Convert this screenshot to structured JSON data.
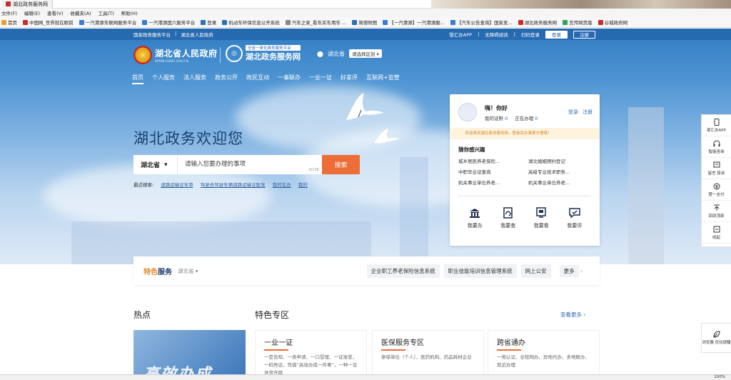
{
  "browser": {
    "tab_title": "湖北政务服务网",
    "menu": [
      "文件(F)",
      "编辑(E)",
      "查看(V)",
      "收藏夹(A)",
      "工具(T)",
      "帮助(H)"
    ],
    "favorites": [
      "首页",
      "中国网_世界就在眼前",
      "一汽港源车联网服务平台",
      "一汽港源国六服务平台",
      "登录",
      "机动车环保信息公开系统",
      "汽车之家_看车买车用车 ...",
      "周德附图",
      "【一汽港源】一汽港源服...",
      "【汽车公告查询】国家发...",
      "湖北政务服务网",
      "互传网页版",
      "谷城政府网"
    ],
    "zoom": "100%"
  },
  "topbar": {
    "left": [
      "国家政务服务平台",
      "湖北省人民政府"
    ],
    "right": [
      "鄂汇办APP",
      "无障碍阅读",
      "扫码登录"
    ],
    "login": "登录",
    "register": "注册"
  },
  "header": {
    "gov_name": "湖北省人民政府",
    "gov_sub": "WWW.HUBEI.GOV.CN",
    "portal_tag": "全省一体化政务服务平台",
    "portal_name": "湖北政务服务网",
    "region": "湖北省",
    "region_select": "请选择区划"
  },
  "nav": [
    "首页",
    "个人服务",
    "法人服务",
    "政务公开",
    "政民互动",
    "一事联办",
    "一业一证",
    "好差评",
    "互联网+监管"
  ],
  "hero": {
    "welcome": "湖北政务欢迎您",
    "province": "湖北省",
    "search_placeholder": "请输入您要办理的事项",
    "counter": "0/128",
    "search_button": "搜索",
    "hot_label": "最近搜索:",
    "hot_links": [
      "道路运输证年审",
      "驾驶员驾驶车辆道路运输证配发",
      "我的在办",
      "我的"
    ]
  },
  "user_card": {
    "greeting": "嗨！你好",
    "cert_label": "我的证照",
    "cert_count": "0",
    "pending_label": "正在办理",
    "pending_count": "0",
    "login": "登录",
    "register": "注册",
    "notice": "· 欢迎来到湖北政务服务网，登录后办事更方便哦！",
    "interest_title": "猜你感兴趣",
    "interests": [
      "城乡居民养老保险...",
      "湖北婚姻预约登记",
      "中职毕业证查询",
      "高级专业技术职务...",
      "机关事业单位养老...",
      "机关事业单位养老..."
    ],
    "actions": [
      {
        "icon": "bank-icon",
        "label": "我要办"
      },
      {
        "icon": "document-icon",
        "label": "我要查"
      },
      {
        "icon": "monitor-icon",
        "label": "我要看"
      },
      {
        "icon": "chat-icon",
        "label": "我要评"
      }
    ]
  },
  "side_tools": [
    {
      "icon": "phone-icon",
      "label": "鄂汇办APP"
    },
    {
      "icon": "headset-icon",
      "label": "智能咨询"
    },
    {
      "icon": "message-icon",
      "label": "留言 投诉"
    },
    {
      "icon": "yuan-icon",
      "label": "楚一支付"
    },
    {
      "icon": "arrow-up-icon",
      "label": "回到顶部"
    },
    {
      "icon": "collapse-icon",
      "label": "收起"
    }
  ],
  "side_tool2": {
    "icon": "leaf-icon",
    "label": "浏览器 优化提醒"
  },
  "featured": {
    "title_a": "特色",
    "title_b": "服务",
    "region": "湖北省",
    "chips": [
      "企业职工养老保险信息系统",
      "职业技能培训信息管理系统",
      "网上公安"
    ],
    "more": "更多"
  },
  "sections": {
    "hot": "热点",
    "special": "特色专区",
    "see_more": "查看更多",
    "hot_banner": "高效办成",
    "cards": [
      {
        "title": "一业一证",
        "desc": "一是告知、一表申请、一口受理、一证准营，一码亮证，凭借“高效办成一件事”，一种一证 准营开辟"
      },
      {
        "title": "医保服务专区",
        "desc": "参保单位（个人）、医药机构、药品耗材企业"
      },
      {
        "title": "跨省通办",
        "desc": "一地认证、全程网办、异地代办、多地联办、就近办理"
      }
    ]
  }
}
